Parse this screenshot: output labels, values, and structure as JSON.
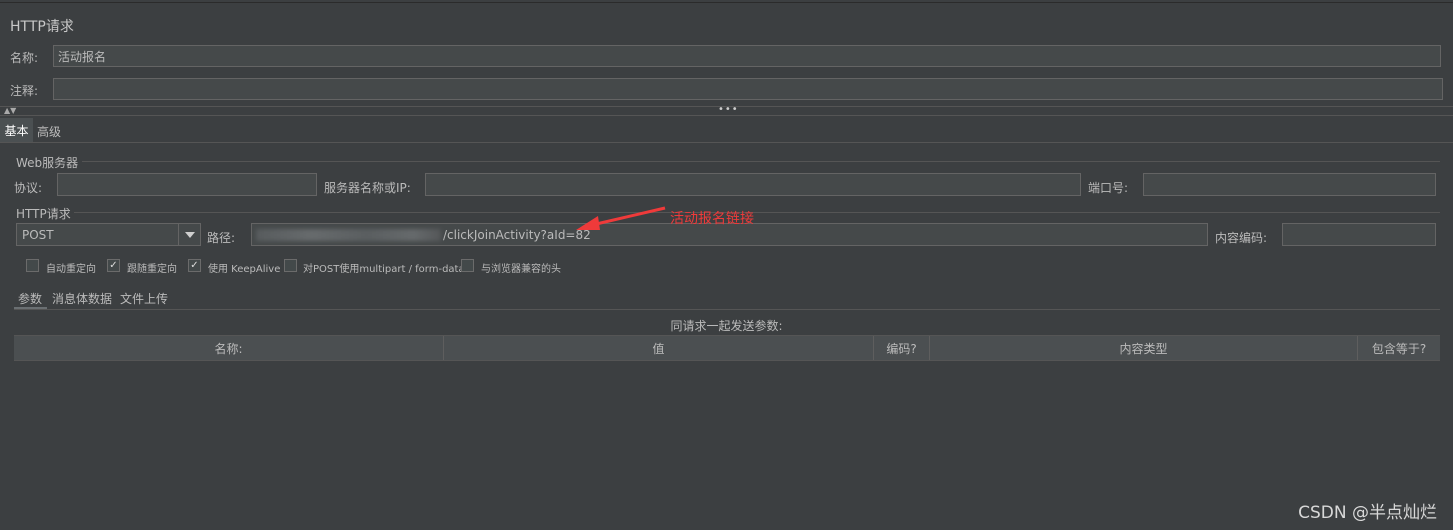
{
  "title": "HTTP请求",
  "name_label": "名称:",
  "name_value": "活动报名",
  "comment_label": "注释:",
  "comment_value": "",
  "tabs": [
    "基本",
    "高级"
  ],
  "web_server": {
    "group_title": "Web服务器",
    "protocol_label": "协议:",
    "protocol_value": "",
    "server_label": "服务器名称或IP:",
    "server_value": "",
    "port_label": "端口号:",
    "port_value": ""
  },
  "http_request": {
    "group_title": "HTTP请求",
    "method": "POST",
    "path_label": "路径:",
    "path_value": "/clickJoinActivity?aId=82",
    "encoding_label": "内容编码:",
    "encoding_value": ""
  },
  "options": [
    {
      "label": "自动重定向",
      "checked": false
    },
    {
      "label": "跟随重定向",
      "checked": true
    },
    {
      "label": "使用 KeepAlive",
      "checked": true
    },
    {
      "label": "对POST使用multipart / form-data",
      "checked": false
    },
    {
      "label": "与浏览器兼容的头",
      "checked": false
    }
  ],
  "sub_tabs": [
    "参数",
    "消息体数据",
    "文件上传"
  ],
  "params_caption": "同请求一起发送参数:",
  "columns": [
    "名称:",
    "值",
    "编码?",
    "内容类型",
    "包含等于?"
  ],
  "annotation": "活动报名链接",
  "watermark": "CSDN @半点灿烂",
  "colors": {
    "background": "#3c3f41",
    "annotation": "#ef3a3a"
  }
}
